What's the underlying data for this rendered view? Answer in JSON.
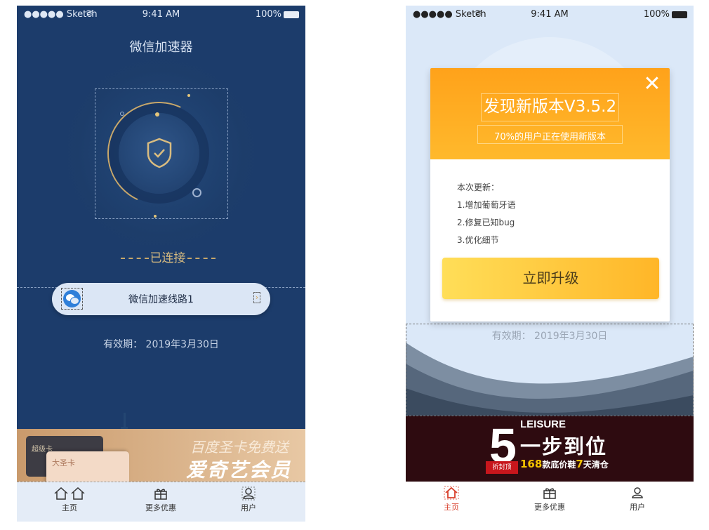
{
  "status_bar": {
    "signal": "●●●●● Sketch",
    "time": "9:41 AM",
    "battery": "100%"
  },
  "left_screen": {
    "title": "微信加速器",
    "connection_status": "已连接",
    "route": {
      "label": "微信加速线路1"
    },
    "validity": "有效期：  2019年3月30日",
    "banner": {
      "card1_text": "超级卡",
      "card2_text": "大圣卡",
      "line1": "百度圣卡免费送",
      "line2": "爱奇艺会员"
    },
    "tabs": [
      {
        "label": "主页"
      },
      {
        "label": "更多优惠"
      },
      {
        "label": "用户"
      }
    ]
  },
  "right_screen": {
    "validity": "有效期：  2019年3月30日",
    "modal": {
      "title": "发现新版本V3.5.2",
      "subtitle": "70%的用户正在使用新版本",
      "changelog_heading": "本次更新：",
      "changelog_items": [
        "1.增加葡萄牙语",
        "2.修复已知bug",
        "3.优化细节"
      ],
      "upgrade_button": "立即升级"
    },
    "banner": {
      "number": "5",
      "tag": "折封顶",
      "headline": "LEISURE",
      "slogan": "一步到位",
      "deal_count": "168",
      "deal_text": "款底价鞋",
      "deal_days": "7",
      "deal_end": "天清仓"
    },
    "tabs": [
      {
        "label": "主页"
      },
      {
        "label": "更多优惠"
      },
      {
        "label": "用户"
      }
    ]
  },
  "colors": {
    "left_bg": "#1c3c6b",
    "accent_gold": "#d9bc80",
    "modal_orange": "#ffa21a",
    "active_tab": "#d9402c"
  }
}
